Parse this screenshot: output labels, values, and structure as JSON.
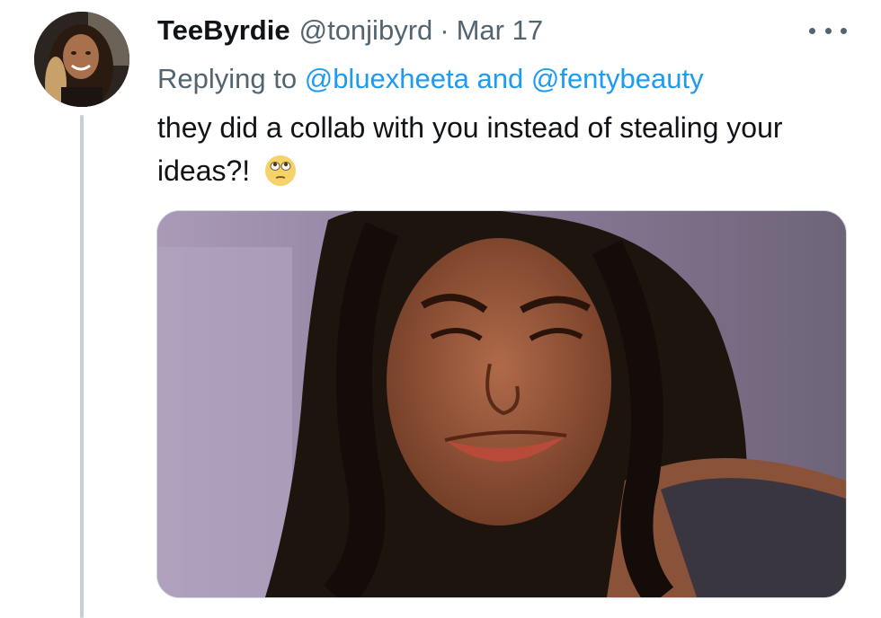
{
  "tweet": {
    "display_name": "TeeByrdie",
    "handle": "@tonjibyrd",
    "separator": "·",
    "date": "Mar 17",
    "replying_prefix": "Replying to",
    "reply_mentions": [
      "@bluexheeta",
      "@fentybeauty"
    ],
    "reply_conjunction": "and",
    "text": "they did a collab with you instead of stealing your ideas?!",
    "emoji": "face-with-rolling-eyes-emoji",
    "media_description_icon": "crying-woman-photo"
  },
  "colors": {
    "accent": "#1d9bf0",
    "secondary_text": "#536471",
    "primary_text": "#0f1419",
    "thread_line": "#c4cfd6"
  }
}
